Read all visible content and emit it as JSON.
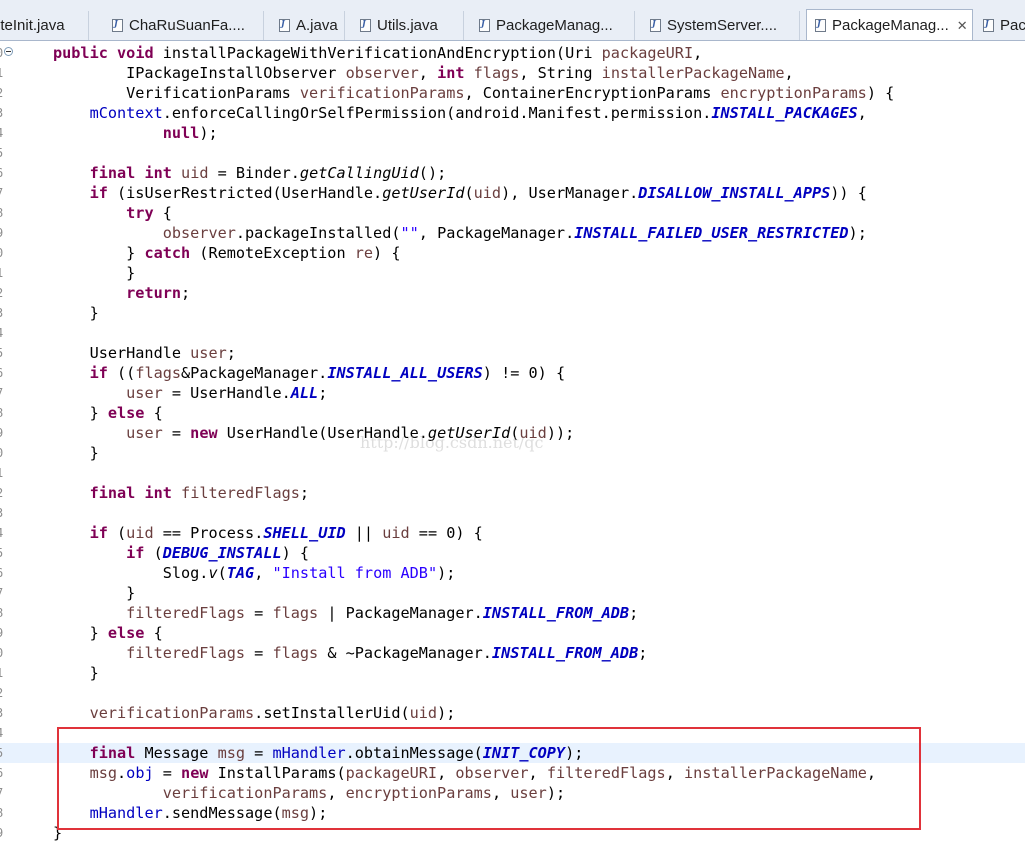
{
  "tabs": [
    {
      "label": "oteInit.java",
      "active": false
    },
    {
      "label": "ChaRuSuanFa....",
      "active": false
    },
    {
      "label": "A.java",
      "active": false
    },
    {
      "label": "Utils.java",
      "active": false
    },
    {
      "label": "PackageManag...",
      "active": false
    },
    {
      "label": "SystemServer....",
      "active": false
    },
    {
      "label": "PackageManag...",
      "active": true
    },
    {
      "label": "Pac",
      "active": false
    }
  ],
  "tab_close_glyph": "✕",
  "watermark": "http://blog.csdn.net/qc",
  "line_numbers": [
    "0",
    "1",
    "2",
    "3",
    "4",
    "5",
    "6",
    "7",
    "8",
    "9",
    "0",
    "1",
    "2",
    "3",
    "4",
    "5",
    "6",
    "7",
    "8",
    "9",
    "0",
    "1",
    "2",
    "3",
    "4",
    "5",
    "6",
    "7",
    "8",
    "9",
    "0",
    "1",
    "2",
    "3",
    "4",
    "5",
    "6",
    "7",
    "8",
    "9",
    "0"
  ],
  "colors": {
    "keyword": "#7f0055",
    "field": "#0000c0",
    "string": "#2a00ff",
    "local_var": "#6a3e3e",
    "highlight_box": "#e0323a",
    "current_line": "#e8f2fe"
  },
  "code_lines": [
    [
      [
        "kw",
        "public"
      ],
      [
        "p",
        " "
      ],
      [
        "kw",
        "void"
      ],
      [
        "p",
        " installPackageWithVerificationAndEncryption(Uri "
      ],
      [
        "var",
        "packageURI"
      ],
      [
        "p",
        ","
      ]
    ],
    [
      [
        "p",
        "        IPackageInstallObserver "
      ],
      [
        "var",
        "observer"
      ],
      [
        "p",
        ", "
      ],
      [
        "kw",
        "int"
      ],
      [
        "p",
        " "
      ],
      [
        "var",
        "flags"
      ],
      [
        "p",
        ", String "
      ],
      [
        "var",
        "installerPackageName"
      ],
      [
        "p",
        ","
      ]
    ],
    [
      [
        "p",
        "        VerificationParams "
      ],
      [
        "var",
        "verificationParams"
      ],
      [
        "p",
        ", ContainerEncryptionParams "
      ],
      [
        "var",
        "encryptionParams"
      ],
      [
        "p",
        ") {"
      ]
    ],
    [
      [
        "p",
        "    "
      ],
      [
        "fld",
        "mContext"
      ],
      [
        "p",
        ".enforceCallingOrSelfPermission(android.Manifest.permission."
      ],
      [
        "sfld",
        "INSTALL_PACKAGES"
      ],
      [
        "p",
        ","
      ]
    ],
    [
      [
        "p",
        "            "
      ],
      [
        "kw",
        "null"
      ],
      [
        "p",
        ");"
      ]
    ],
    [
      [
        "p",
        ""
      ]
    ],
    [
      [
        "p",
        "    "
      ],
      [
        "kw",
        "final"
      ],
      [
        "p",
        " "
      ],
      [
        "kw",
        "int"
      ],
      [
        "p",
        " "
      ],
      [
        "var",
        "uid"
      ],
      [
        "p",
        " = Binder."
      ],
      [
        "smeth",
        "getCallingUid"
      ],
      [
        "p",
        "();"
      ]
    ],
    [
      [
        "p",
        "    "
      ],
      [
        "kw",
        "if"
      ],
      [
        "p",
        " (isUserRestricted(UserHandle."
      ],
      [
        "smeth",
        "getUserId"
      ],
      [
        "p",
        "("
      ],
      [
        "var",
        "uid"
      ],
      [
        "p",
        "), UserManager."
      ],
      [
        "sfld",
        "DISALLOW_INSTALL_APPS"
      ],
      [
        "p",
        ")) {"
      ]
    ],
    [
      [
        "p",
        "        "
      ],
      [
        "kw",
        "try"
      ],
      [
        "p",
        " {"
      ]
    ],
    [
      [
        "p",
        "            "
      ],
      [
        "var",
        "observer"
      ],
      [
        "p",
        ".packageInstalled("
      ],
      [
        "str",
        "\"\""
      ],
      [
        "p",
        ", PackageManager."
      ],
      [
        "sfld",
        "INSTALL_FAILED_USER_RESTRICTED"
      ],
      [
        "p",
        ");"
      ]
    ],
    [
      [
        "p",
        "        } "
      ],
      [
        "kw",
        "catch"
      ],
      [
        "p",
        " (RemoteException "
      ],
      [
        "var",
        "re"
      ],
      [
        "p",
        ") {"
      ]
    ],
    [
      [
        "p",
        "        }"
      ]
    ],
    [
      [
        "p",
        "        "
      ],
      [
        "kw",
        "return"
      ],
      [
        "p",
        ";"
      ]
    ],
    [
      [
        "p",
        "    }"
      ]
    ],
    [
      [
        "p",
        ""
      ]
    ],
    [
      [
        "p",
        "    UserHandle "
      ],
      [
        "var",
        "user"
      ],
      [
        "p",
        ";"
      ]
    ],
    [
      [
        "p",
        "    "
      ],
      [
        "kw",
        "if"
      ],
      [
        "p",
        " (("
      ],
      [
        "var",
        "flags"
      ],
      [
        "p",
        "&PackageManager."
      ],
      [
        "sfld",
        "INSTALL_ALL_USERS"
      ],
      [
        "p",
        ") != 0) {"
      ]
    ],
    [
      [
        "p",
        "        "
      ],
      [
        "var",
        "user"
      ],
      [
        "p",
        " = UserHandle."
      ],
      [
        "sfld",
        "ALL"
      ],
      [
        "p",
        ";"
      ]
    ],
    [
      [
        "p",
        "    } "
      ],
      [
        "kw",
        "else"
      ],
      [
        "p",
        " {"
      ]
    ],
    [
      [
        "p",
        "        "
      ],
      [
        "var",
        "user"
      ],
      [
        "p",
        " = "
      ],
      [
        "kw",
        "new"
      ],
      [
        "p",
        " UserHandle(UserHandle."
      ],
      [
        "smeth",
        "getUserId"
      ],
      [
        "p",
        "("
      ],
      [
        "var",
        "uid"
      ],
      [
        "p",
        "));"
      ]
    ],
    [
      [
        "p",
        "    }"
      ]
    ],
    [
      [
        "p",
        ""
      ]
    ],
    [
      [
        "p",
        "    "
      ],
      [
        "kw",
        "final"
      ],
      [
        "p",
        " "
      ],
      [
        "kw",
        "int"
      ],
      [
        "p",
        " "
      ],
      [
        "var",
        "filteredFlags"
      ],
      [
        "p",
        ";"
      ]
    ],
    [
      [
        "p",
        ""
      ]
    ],
    [
      [
        "p",
        "    "
      ],
      [
        "kw",
        "if"
      ],
      [
        "p",
        " ("
      ],
      [
        "var",
        "uid"
      ],
      [
        "p",
        " == Process."
      ],
      [
        "sfld",
        "SHELL_UID"
      ],
      [
        "p",
        " || "
      ],
      [
        "var",
        "uid"
      ],
      [
        "p",
        " == 0) {"
      ]
    ],
    [
      [
        "p",
        "        "
      ],
      [
        "kw",
        "if"
      ],
      [
        "p",
        " ("
      ],
      [
        "sfld",
        "DEBUG_INSTALL"
      ],
      [
        "p",
        ") {"
      ]
    ],
    [
      [
        "p",
        "            Slog."
      ],
      [
        "smeth",
        "v"
      ],
      [
        "p",
        "("
      ],
      [
        "sfld",
        "TAG"
      ],
      [
        "p",
        ", "
      ],
      [
        "str",
        "\"Install from ADB\""
      ],
      [
        "p",
        ");"
      ]
    ],
    [
      [
        "p",
        "        }"
      ]
    ],
    [
      [
        "p",
        "        "
      ],
      [
        "var",
        "filteredFlags"
      ],
      [
        "p",
        " = "
      ],
      [
        "var",
        "flags"
      ],
      [
        "p",
        " | PackageManager."
      ],
      [
        "sfld",
        "INSTALL_FROM_ADB"
      ],
      [
        "p",
        ";"
      ]
    ],
    [
      [
        "p",
        "    } "
      ],
      [
        "kw",
        "else"
      ],
      [
        "p",
        " {"
      ]
    ],
    [
      [
        "p",
        "        "
      ],
      [
        "var",
        "filteredFlags"
      ],
      [
        "p",
        " = "
      ],
      [
        "var",
        "flags"
      ],
      [
        "p",
        " & ~PackageManager."
      ],
      [
        "sfld",
        "INSTALL_FROM_ADB"
      ],
      [
        "p",
        ";"
      ]
    ],
    [
      [
        "p",
        "    }"
      ]
    ],
    [
      [
        "p",
        ""
      ]
    ],
    [
      [
        "p",
        "    "
      ],
      [
        "var",
        "verificationParams"
      ],
      [
        "p",
        ".setInstallerUid("
      ],
      [
        "var",
        "uid"
      ],
      [
        "p",
        ");"
      ]
    ],
    [
      [
        "p",
        ""
      ]
    ],
    [
      [
        "p",
        "    "
      ],
      [
        "kw",
        "final"
      ],
      [
        "p",
        " Message "
      ],
      [
        "var",
        "msg"
      ],
      [
        "p",
        " = "
      ],
      [
        "fld",
        "mHandler"
      ],
      [
        "p",
        ".obtainMessage("
      ],
      [
        "sfld",
        "INIT_COPY"
      ],
      [
        "p",
        ");"
      ]
    ],
    [
      [
        "p",
        "    "
      ],
      [
        "var",
        "msg"
      ],
      [
        "p",
        "."
      ],
      [
        "fld",
        "obj"
      ],
      [
        "p",
        " = "
      ],
      [
        "kw",
        "new"
      ],
      [
        "p",
        " InstallParams("
      ],
      [
        "var",
        "packageURI"
      ],
      [
        "p",
        ", "
      ],
      [
        "var",
        "observer"
      ],
      [
        "p",
        ", "
      ],
      [
        "var",
        "filteredFlags"
      ],
      [
        "p",
        ", "
      ],
      [
        "var",
        "installerPackageName"
      ],
      [
        "p",
        ","
      ]
    ],
    [
      [
        "p",
        "            "
      ],
      [
        "var",
        "verificationParams"
      ],
      [
        "p",
        ", "
      ],
      [
        "var",
        "encryptionParams"
      ],
      [
        "p",
        ", "
      ],
      [
        "var",
        "user"
      ],
      [
        "p",
        ");"
      ]
    ],
    [
      [
        "p",
        "    "
      ],
      [
        "fld",
        "mHandler"
      ],
      [
        "p",
        ".sendMessage("
      ],
      [
        "var",
        "msg"
      ],
      [
        "p",
        ");"
      ]
    ],
    [
      [
        "p",
        "}"
      ]
    ]
  ],
  "current_line_index": 35
}
